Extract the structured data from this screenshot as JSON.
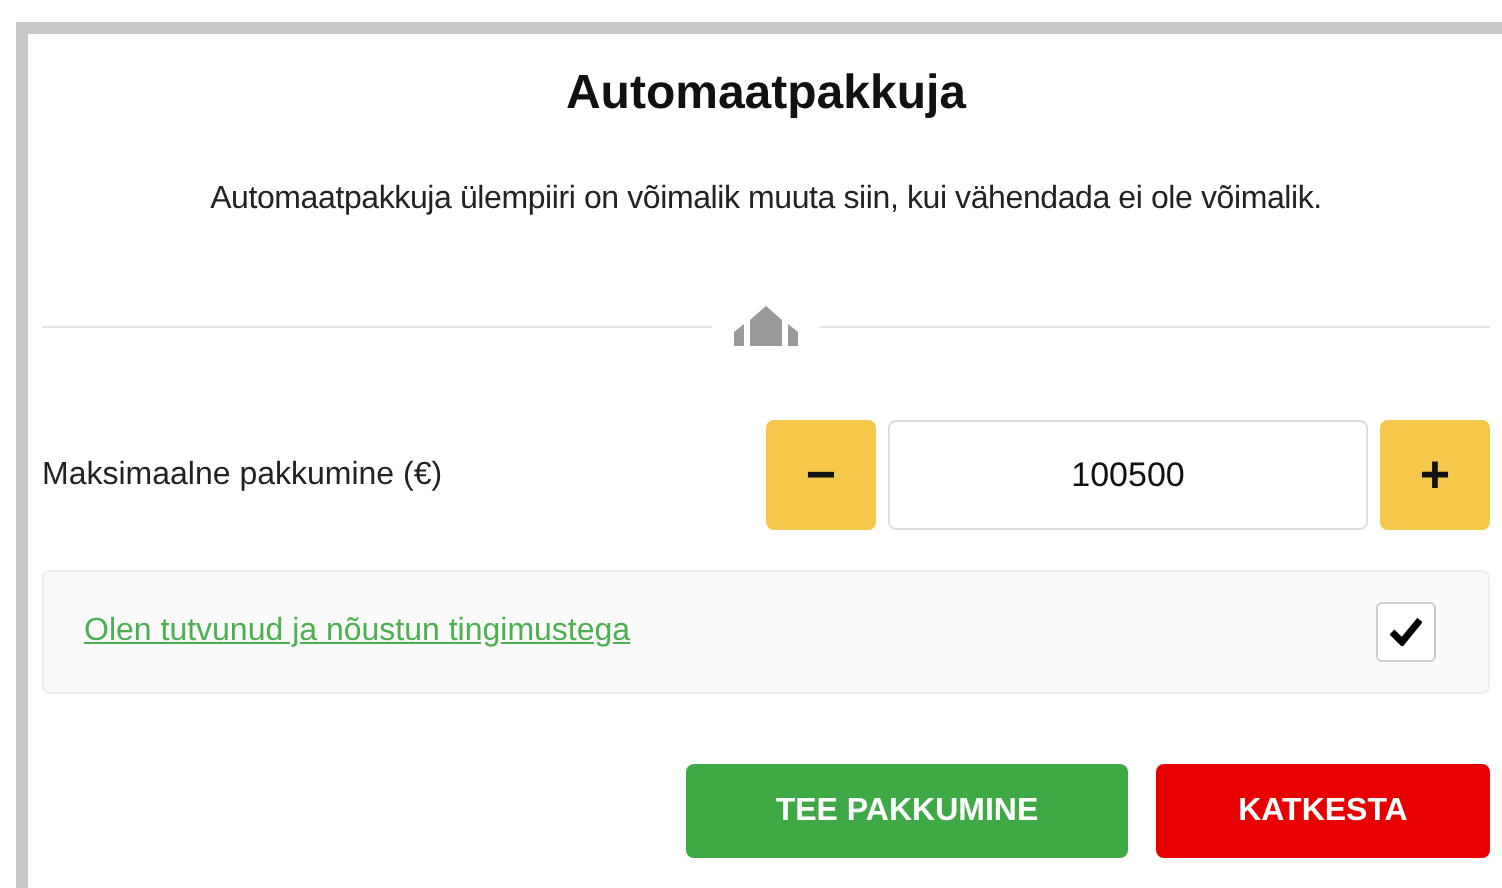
{
  "dialog": {
    "title": "Automaatpakkuja",
    "description": "Automaatpakkuja ülempiiri on võimalik muuta siin, kui vähendada ei ole võimalik."
  },
  "max_bid": {
    "label": "Maksimaalne pakkumine (€)",
    "decrement": "−",
    "value": "100500",
    "increment": "+"
  },
  "terms": {
    "link": "Olen tutvunud ja nõustun tingimustega",
    "checked": true
  },
  "buttons": [
    {
      "label": "TEE PAKKUMINE",
      "kind": "primary"
    },
    {
      "label": "KATKESTA",
      "kind": "danger"
    }
  ]
}
